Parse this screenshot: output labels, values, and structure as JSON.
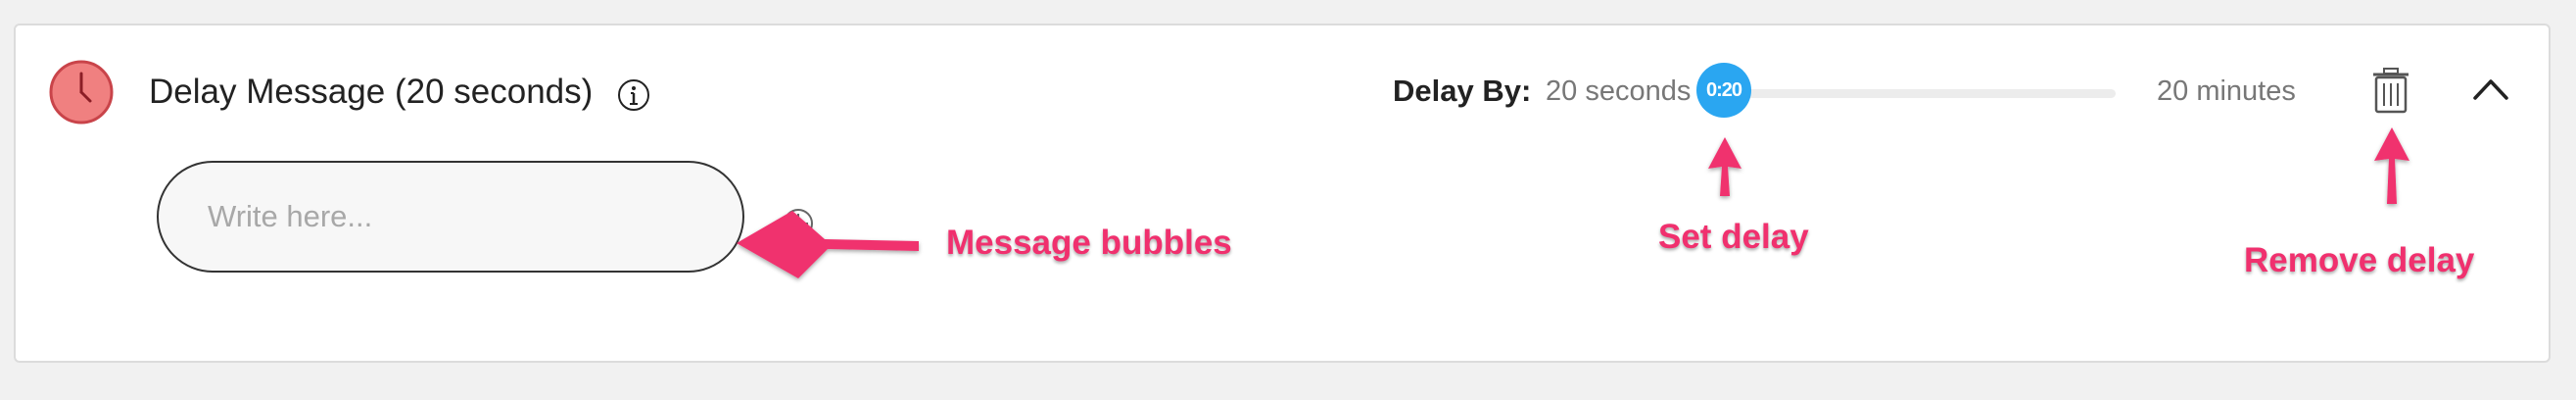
{
  "header": {
    "title": "Delay Message (20 seconds)",
    "info_icon": "info-icon",
    "clock_icon": "clock-icon"
  },
  "delay": {
    "label": "Delay By:",
    "min_label": "20 seconds",
    "value_label": "0:20",
    "max_label": "20 minutes",
    "value_fraction": 0.0
  },
  "actions": {
    "delete_icon": "trash-icon",
    "collapse_icon": "chevron-up-icon"
  },
  "message": {
    "placeholder": "Write here..."
  },
  "annotations": {
    "message_bubbles": "Message bubbles",
    "set_delay": "Set delay",
    "remove_delay": "Remove delay"
  },
  "colors": {
    "accent": "#2aa6f1",
    "clock_fill": "#f08080",
    "clock_stroke": "#c9444a",
    "annotation": "#f0306e"
  }
}
